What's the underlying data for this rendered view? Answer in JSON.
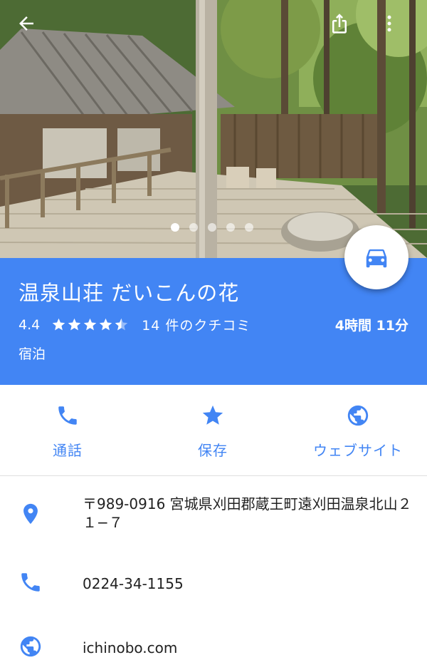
{
  "header": {
    "photo": "cabin-deck-forest-photo",
    "icons": [
      "arrow-back-icon",
      "share-icon",
      "more-vert-icon"
    ],
    "photo_pages": 5,
    "photo_active_page": 1
  },
  "place": {
    "name": "温泉山荘 だいこんの花",
    "rating": "4.4",
    "rating_value": 4.4,
    "rating_max": 5,
    "reviews": "14 件のクチコミ",
    "drive_time": "4時間 11分",
    "category": "宿泊"
  },
  "fab": {
    "icon": "directions-car-icon"
  },
  "actions": [
    {
      "label": "通話",
      "icon": "phone-icon"
    },
    {
      "label": "保存",
      "icon": "star-icon"
    },
    {
      "label": "ウェブサイト",
      "icon": "globe-icon"
    }
  ],
  "details": {
    "address": "〒989-0916 宮城県刈田郡蔵王町遠刈田温泉北山２１−７",
    "phone": "0224-34-1155",
    "website": "ichinobo.com"
  },
  "colors": {
    "accent": "#4285f4",
    "text": "#212121",
    "divider": "#dedede"
  }
}
